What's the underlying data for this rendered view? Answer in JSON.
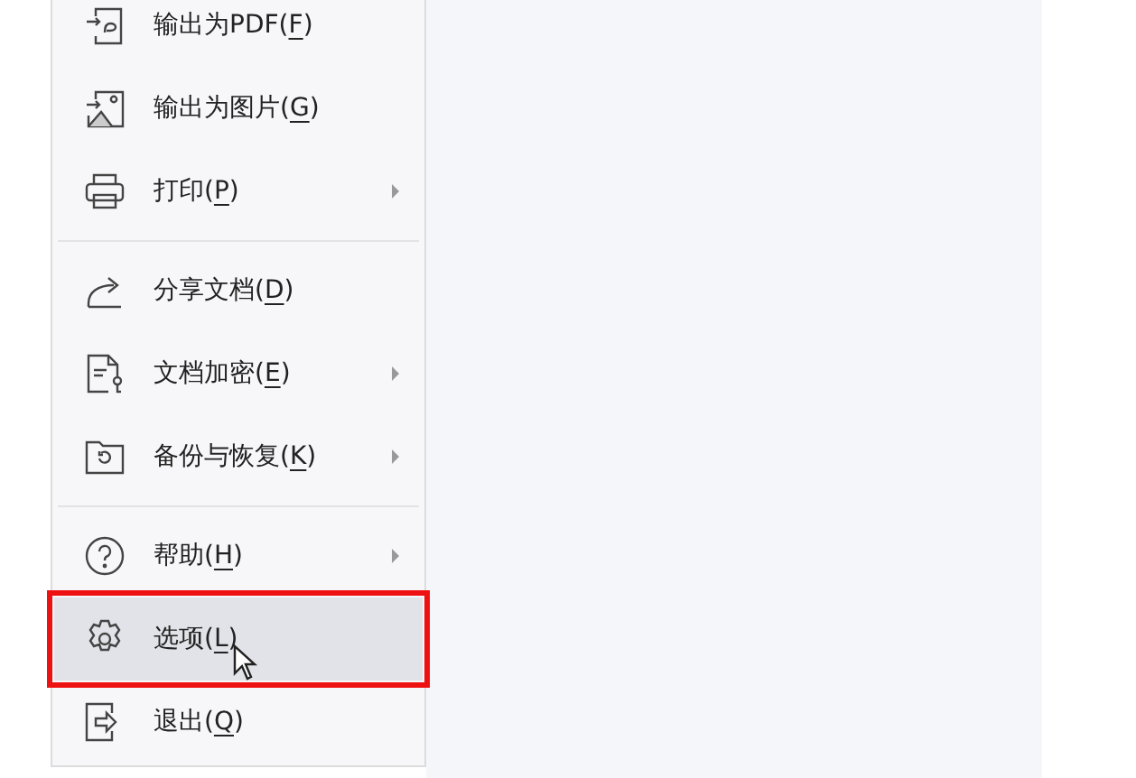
{
  "menu": {
    "groups": [
      {
        "items": [
          {
            "label": "输出为PDF(F)",
            "has_submenu": false,
            "selected": false
          },
          {
            "label": "输出为图片(G)",
            "has_submenu": false,
            "selected": false
          },
          {
            "label": "打印(P)",
            "has_submenu": true,
            "selected": false
          }
        ]
      },
      {
        "items": [
          {
            "label": "分享文档(D)",
            "has_submenu": false,
            "selected": false
          },
          {
            "label": "文档加密(E)",
            "has_submenu": true,
            "selected": false
          },
          {
            "label": "备份与恢复(K)",
            "has_submenu": true,
            "selected": false
          }
        ]
      },
      {
        "items": [
          {
            "label": "帮助(H)",
            "has_submenu": true,
            "selected": false
          },
          {
            "label": "选项(L)",
            "has_submenu": false,
            "selected": true
          },
          {
            "label": "退出(Q)",
            "has_submenu": false,
            "selected": false
          }
        ]
      }
    ]
  }
}
